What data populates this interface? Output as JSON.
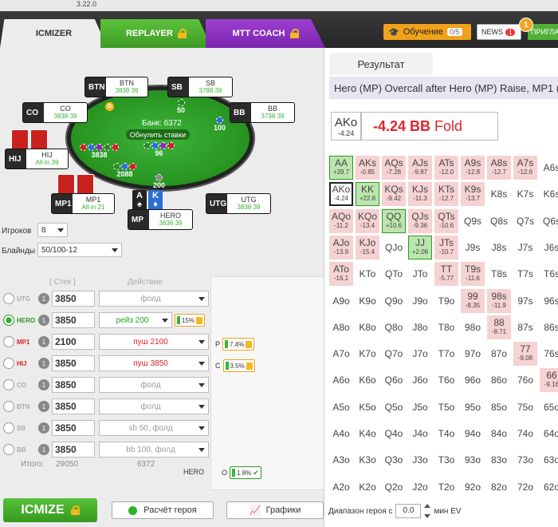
{
  "version": "3.22.0",
  "tabs": [
    {
      "label": "ICMIZER",
      "active": true
    },
    {
      "label": "REPLAYER",
      "locked": true
    },
    {
      "label": "MTT COACH",
      "locked": true
    }
  ],
  "header": {
    "learn_label": "Обучение",
    "learn_progress": "0/5",
    "news_label": "NEWS",
    "news_count": "1",
    "plans_label": "ПРИГЛА",
    "notif_count": "1"
  },
  "table": {
    "pot_label": "Банк: 6372",
    "reset_label": "Обнулить ставки",
    "seats": [
      {
        "pos": "BTN",
        "name": "BTN",
        "stack": "3838",
        "bb": "39"
      },
      {
        "pos": "SB",
        "name": "SB",
        "stack": "3788",
        "bb": "39"
      },
      {
        "pos": "CO",
        "name": "CO",
        "stack": "3838",
        "bb": "39"
      },
      {
        "pos": "BB",
        "name": "BB",
        "stack": "3738",
        "bb": "39"
      },
      {
        "pos": "HIJ",
        "name": "HIJ",
        "stack": "All-in",
        "bb": "39"
      },
      {
        "pos": "MP1",
        "name": "MP1",
        "stack": "All-in",
        "bb": "21"
      },
      {
        "pos": "UTG",
        "name": "UTG",
        "stack": "3838",
        "bb": "39"
      },
      {
        "pos": "MP",
        "name": "HERO",
        "stack": "3638",
        "bb": "39"
      }
    ],
    "bets": {
      "sb": "50",
      "bb": "100",
      "hij": "3838",
      "mp1": "2088",
      "hero": "200",
      "pot_center": "96"
    },
    "hero_cards": [
      {
        "rank": "A",
        "suit": "♠"
      },
      {
        "rank": "K",
        "suit": "♦"
      }
    ]
  },
  "settings": {
    "players_label": "Игроков",
    "players_value": "8",
    "blinds_label": "Блайнды",
    "blinds_value": "50/100-12"
  },
  "players_table": {
    "stack_header": "Стек",
    "action_header": "Действие",
    "rows": [
      {
        "name": "UTG",
        "count": "1",
        "stack": "3850",
        "action": "фолд",
        "style": "gray"
      },
      {
        "name": "HERO",
        "count": "1",
        "stack": "3850",
        "action": "рейз 200",
        "style": "green",
        "pct": "15%"
      },
      {
        "name": "MP1",
        "count": "1",
        "stack": "2100",
        "action": "пуш 2100",
        "style": "red",
        "range_label": "Р",
        "range_pct": "7.4%"
      },
      {
        "name": "HIJ",
        "count": "1",
        "stack": "3850",
        "action": "пуш 3850",
        "style": "red",
        "range_label": "С",
        "range_pct": "3.5%"
      },
      {
        "name": "CO",
        "count": "1",
        "stack": "3850",
        "action": "фолд",
        "style": "gray"
      },
      {
        "name": "BTN",
        "count": "1",
        "stack": "3850",
        "action": "фолд",
        "style": "gray"
      },
      {
        "name": "SB",
        "count": "1",
        "stack": "3850",
        "action": "sb 50, фолд",
        "style": "gray"
      },
      {
        "name": "BB",
        "count": "1",
        "stack": "3850",
        "action": "bb 100, фолд",
        "style": "gray"
      }
    ],
    "total_label": "Итого:",
    "total_value": "29050",
    "total_right": "6372",
    "hero_label": "HERO",
    "hero_range_label": "О",
    "hero_range_pct": "1.8%"
  },
  "buttons": {
    "icmize": "ICMIZE",
    "calc": "Расчёт героя",
    "charts": "Графики"
  },
  "result": {
    "tab_label": "Результат",
    "header": "Hero (MP) Overcall after Hero (MP) Raise, MP1 (MP1) Push, HIJ (HIJ) Push",
    "combo": "AKo",
    "combo_ev": "-4.24",
    "ev_value": "-4.24 BB",
    "ev_action": "Fold",
    "footer_label": "Диапазон героя с",
    "min_ev": "0.0",
    "footer_unit": "мин EV"
  },
  "grid": {
    "cells": [
      {
        "h": "AA",
        "v": "+39.7",
        "t": "pos",
        "r": 0,
        "c": 0
      },
      {
        "h": "AKs",
        "v": "-0.85",
        "t": "neg",
        "r": 0,
        "c": 1
      },
      {
        "h": "AQs",
        "v": "-7.28",
        "t": "neg",
        "r": 0,
        "c": 2
      },
      {
        "h": "AJs",
        "v": "-9.87",
        "t": "neg",
        "r": 0,
        "c": 3
      },
      {
        "h": "ATs",
        "v": "-12.0",
        "t": "neg",
        "r": 0,
        "c": 4
      },
      {
        "h": "A9s",
        "v": "-12.8",
        "t": "neg",
        "r": 0,
        "c": 5
      },
      {
        "h": "A8s",
        "v": "-12.7",
        "t": "neg",
        "r": 0,
        "c": 6
      },
      {
        "h": "A7s",
        "v": "-12.6",
        "t": "neg",
        "r": 0,
        "c": 7
      },
      {
        "h": "A6s",
        "v": "",
        "t": "",
        "r": 0,
        "c": 8
      },
      {
        "h": "AKo",
        "v": "-4.24",
        "t": "sel",
        "r": 1,
        "c": 0
      },
      {
        "h": "KK",
        "v": "+22.8",
        "t": "pos",
        "r": 1,
        "c": 1
      },
      {
        "h": "KQs",
        "v": "-9.42",
        "t": "neg",
        "r": 1,
        "c": 2
      },
      {
        "h": "KJs",
        "v": "-11.3",
        "t": "neg",
        "r": 1,
        "c": 3
      },
      {
        "h": "KTs",
        "v": "-12.7",
        "t": "neg",
        "r": 1,
        "c": 4
      },
      {
        "h": "K9s",
        "v": "-13.7",
        "t": "neg",
        "r": 1,
        "c": 5
      },
      {
        "h": "K8s",
        "v": "",
        "t": "",
        "r": 1,
        "c": 6
      },
      {
        "h": "K7s",
        "v": "",
        "t": "",
        "r": 1,
        "c": 7
      },
      {
        "h": "K6s",
        "v": "",
        "t": "",
        "r": 1,
        "c": 8
      },
      {
        "h": "AQo",
        "v": "-11.2",
        "t": "neg",
        "r": 2,
        "c": 0
      },
      {
        "h": "KQo",
        "v": "-13.4",
        "t": "neg",
        "r": 2,
        "c": 1
      },
      {
        "h": "QQ",
        "v": "+10.6",
        "t": "pos",
        "r": 2,
        "c": 2
      },
      {
        "h": "QJs",
        "v": "-9.36",
        "t": "neg",
        "r": 2,
        "c": 3
      },
      {
        "h": "QTs",
        "v": "-10.6",
        "t": "neg",
        "r": 2,
        "c": 4
      },
      {
        "h": "Q9s",
        "v": "",
        "t": "",
        "r": 2,
        "c": 5
      },
      {
        "h": "Q8s",
        "v": "",
        "t": "",
        "r": 2,
        "c": 6
      },
      {
        "h": "Q7s",
        "v": "",
        "t": "",
        "r": 2,
        "c": 7
      },
      {
        "h": "Q6s",
        "v": "",
        "t": "",
        "r": 2,
        "c": 8
      },
      {
        "h": "AJo",
        "v": "-13.9",
        "t": "neg",
        "r": 3,
        "c": 0
      },
      {
        "h": "KJo",
        "v": "-15.4",
        "t": "neg",
        "r": 3,
        "c": 1
      },
      {
        "h": "QJo",
        "v": "",
        "t": "",
        "r": 3,
        "c": 2
      },
      {
        "h": "JJ",
        "v": "+2.06",
        "t": "pos",
        "r": 3,
        "c": 3
      },
      {
        "h": "JTs",
        "v": "-10.7",
        "t": "neg",
        "r": 3,
        "c": 4
      },
      {
        "h": "J9s",
        "v": "",
        "t": "",
        "r": 3,
        "c": 5
      },
      {
        "h": "J8s",
        "v": "",
        "t": "",
        "r": 3,
        "c": 6
      },
      {
        "h": "J7s",
        "v": "",
        "t": "",
        "r": 3,
        "c": 7
      },
      {
        "h": "J6s",
        "v": "",
        "t": "",
        "r": 3,
        "c": 8
      },
      {
        "h": "ATo",
        "v": "-16.1",
        "t": "neg",
        "r": 4,
        "c": 0
      },
      {
        "h": "KTo",
        "v": "",
        "t": "",
        "r": 4,
        "c": 1
      },
      {
        "h": "QTo",
        "v": "",
        "t": "",
        "r": 4,
        "c": 2
      },
      {
        "h": "JTo",
        "v": "",
        "t": "",
        "r": 4,
        "c": 3
      },
      {
        "h": "TT",
        "v": "-5.77",
        "t": "neg",
        "r": 4,
        "c": 4
      },
      {
        "h": "T9s",
        "v": "-11.6",
        "t": "neg",
        "r": 4,
        "c": 5
      },
      {
        "h": "T8s",
        "v": "",
        "t": "",
        "r": 4,
        "c": 6
      },
      {
        "h": "T7s",
        "v": "",
        "t": "",
        "r": 4,
        "c": 7
      },
      {
        "h": "T6s",
        "v": "",
        "t": "",
        "r": 4,
        "c": 8
      },
      {
        "h": "A9o",
        "v": "",
        "t": "",
        "r": 5,
        "c": 0
      },
      {
        "h": "K9o",
        "v": "",
        "t": "",
        "r": 5,
        "c": 1
      },
      {
        "h": "Q9o",
        "v": "",
        "t": "",
        "r": 5,
        "c": 2
      },
      {
        "h": "J9o",
        "v": "",
        "t": "",
        "r": 5,
        "c": 3
      },
      {
        "h": "T9o",
        "v": "",
        "t": "",
        "r": 5,
        "c": 4
      },
      {
        "h": "99",
        "v": "-8.35",
        "t": "neg",
        "r": 5,
        "c": 5
      },
      {
        "h": "98s",
        "v": "-11.9",
        "t": "neg",
        "r": 5,
        "c": 6
      },
      {
        "h": "97s",
        "v": "",
        "t": "",
        "r": 5,
        "c": 7
      },
      {
        "h": "96s",
        "v": "",
        "t": "",
        "r": 5,
        "c": 8
      },
      {
        "h": "A8o",
        "v": "",
        "t": "",
        "r": 6,
        "c": 0
      },
      {
        "h": "K8o",
        "v": "",
        "t": "",
        "r": 6,
        "c": 1
      },
      {
        "h": "Q8o",
        "v": "",
        "t": "",
        "r": 6,
        "c": 2
      },
      {
        "h": "J8o",
        "v": "",
        "t": "",
        "r": 6,
        "c": 3
      },
      {
        "h": "T8o",
        "v": "",
        "t": "",
        "r": 6,
        "c": 4
      },
      {
        "h": "98o",
        "v": "",
        "t": "",
        "r": 6,
        "c": 5
      },
      {
        "h": "88",
        "v": "-8.71",
        "t": "neg",
        "r": 6,
        "c": 6
      },
      {
        "h": "87s",
        "v": "",
        "t": "",
        "r": 6,
        "c": 7
      },
      {
        "h": "86s",
        "v": "",
        "t": "",
        "r": 6,
        "c": 8
      },
      {
        "h": "A7o",
        "v": "",
        "t": "",
        "r": 7,
        "c": 0
      },
      {
        "h": "K7o",
        "v": "",
        "t": "",
        "r": 7,
        "c": 1
      },
      {
        "h": "Q7o",
        "v": "",
        "t": "",
        "r": 7,
        "c": 2
      },
      {
        "h": "J7o",
        "v": "",
        "t": "",
        "r": 7,
        "c": 3
      },
      {
        "h": "T7o",
        "v": "",
        "t": "",
        "r": 7,
        "c": 4
      },
      {
        "h": "97o",
        "v": "",
        "t": "",
        "r": 7,
        "c": 5
      },
      {
        "h": "87o",
        "v": "",
        "t": "",
        "r": 7,
        "c": 6
      },
      {
        "h": "77",
        "v": "-9.08",
        "t": "neg",
        "r": 7,
        "c": 7
      },
      {
        "h": "76s",
        "v": "",
        "t": "",
        "r": 7,
        "c": 8
      },
      {
        "h": "A6o",
        "v": "",
        "t": "",
        "r": 8,
        "c": 0
      },
      {
        "h": "K6o",
        "v": "",
        "t": "",
        "r": 8,
        "c": 1
      },
      {
        "h": "Q6o",
        "v": "",
        "t": "",
        "r": 8,
        "c": 2
      },
      {
        "h": "J6o",
        "v": "",
        "t": "",
        "r": 8,
        "c": 3
      },
      {
        "h": "T6o",
        "v": "",
        "t": "",
        "r": 8,
        "c": 4
      },
      {
        "h": "96o",
        "v": "",
        "t": "",
        "r": 8,
        "c": 5
      },
      {
        "h": "86o",
        "v": "",
        "t": "",
        "r": 8,
        "c": 6
      },
      {
        "h": "76o",
        "v": "",
        "t": "",
        "r": 8,
        "c": 7
      },
      {
        "h": "66",
        "v": "-9.16",
        "t": "neg",
        "r": 8,
        "c": 8
      },
      {
        "h": "A5o",
        "v": "",
        "t": "",
        "r": 9,
        "c": 0
      },
      {
        "h": "K5o",
        "v": "",
        "t": "",
        "r": 9,
        "c": 1
      },
      {
        "h": "Q5o",
        "v": "",
        "t": "",
        "r": 9,
        "c": 2
      },
      {
        "h": "J5o",
        "v": "",
        "t": "",
        "r": 9,
        "c": 3
      },
      {
        "h": "T5o",
        "v": "",
        "t": "",
        "r": 9,
        "c": 4
      },
      {
        "h": "95o",
        "v": "",
        "t": "",
        "r": 9,
        "c": 5
      },
      {
        "h": "85o",
        "v": "",
        "t": "",
        "r": 9,
        "c": 6
      },
      {
        "h": "75o",
        "v": "",
        "t": "",
        "r": 9,
        "c": 7
      },
      {
        "h": "65o",
        "v": "",
        "t": "",
        "r": 9,
        "c": 8
      },
      {
        "h": "A4o",
        "v": "",
        "t": "",
        "r": 10,
        "c": 0
      },
      {
        "h": "K4o",
        "v": "",
        "t": "",
        "r": 10,
        "c": 1
      },
      {
        "h": "Q4o",
        "v": "",
        "t": "",
        "r": 10,
        "c": 2
      },
      {
        "h": "J4o",
        "v": "",
        "t": "",
        "r": 10,
        "c": 3
      },
      {
        "h": "T4o",
        "v": "",
        "t": "",
        "r": 10,
        "c": 4
      },
      {
        "h": "94o",
        "v": "",
        "t": "",
        "r": 10,
        "c": 5
      },
      {
        "h": "84o",
        "v": "",
        "t": "",
        "r": 10,
        "c": 6
      },
      {
        "h": "74o",
        "v": "",
        "t": "",
        "r": 10,
        "c": 7
      },
      {
        "h": "64o",
        "v": "",
        "t": "",
        "r": 10,
        "c": 8
      },
      {
        "h": "A3o",
        "v": "",
        "t": "",
        "r": 11,
        "c": 0
      },
      {
        "h": "K3o",
        "v": "",
        "t": "",
        "r": 11,
        "c": 1
      },
      {
        "h": "Q3o",
        "v": "",
        "t": "",
        "r": 11,
        "c": 2
      },
      {
        "h": "J3o",
        "v": "",
        "t": "",
        "r": 11,
        "c": 3
      },
      {
        "h": "T3o",
        "v": "",
        "t": "",
        "r": 11,
        "c": 4
      },
      {
        "h": "93o",
        "v": "",
        "t": "",
        "r": 11,
        "c": 5
      },
      {
        "h": "83o",
        "v": "",
        "t": "",
        "r": 11,
        "c": 6
      },
      {
        "h": "73o",
        "v": "",
        "t": "",
        "r": 11,
        "c": 7
      },
      {
        "h": "63o",
        "v": "",
        "t": "",
        "r": 11,
        "c": 8
      },
      {
        "h": "A2o",
        "v": "",
        "t": "",
        "r": 12,
        "c": 0
      },
      {
        "h": "K2o",
        "v": "",
        "t": "",
        "r": 12,
        "c": 1
      },
      {
        "h": "Q2o",
        "v": "",
        "t": "",
        "r": 12,
        "c": 2
      },
      {
        "h": "J2o",
        "v": "",
        "t": "",
        "r": 12,
        "c": 3
      },
      {
        "h": "T2o",
        "v": "",
        "t": "",
        "r": 12,
        "c": 4
      },
      {
        "h": "92o",
        "v": "",
        "t": "",
        "r": 12,
        "c": 5
      },
      {
        "h": "82o",
        "v": "",
        "t": "",
        "r": 12,
        "c": 6
      },
      {
        "h": "72o",
        "v": "",
        "t": "",
        "r": 12,
        "c": 7
      },
      {
        "h": "62o",
        "v": "",
        "t": "",
        "r": 12,
        "c": 8
      }
    ]
  }
}
